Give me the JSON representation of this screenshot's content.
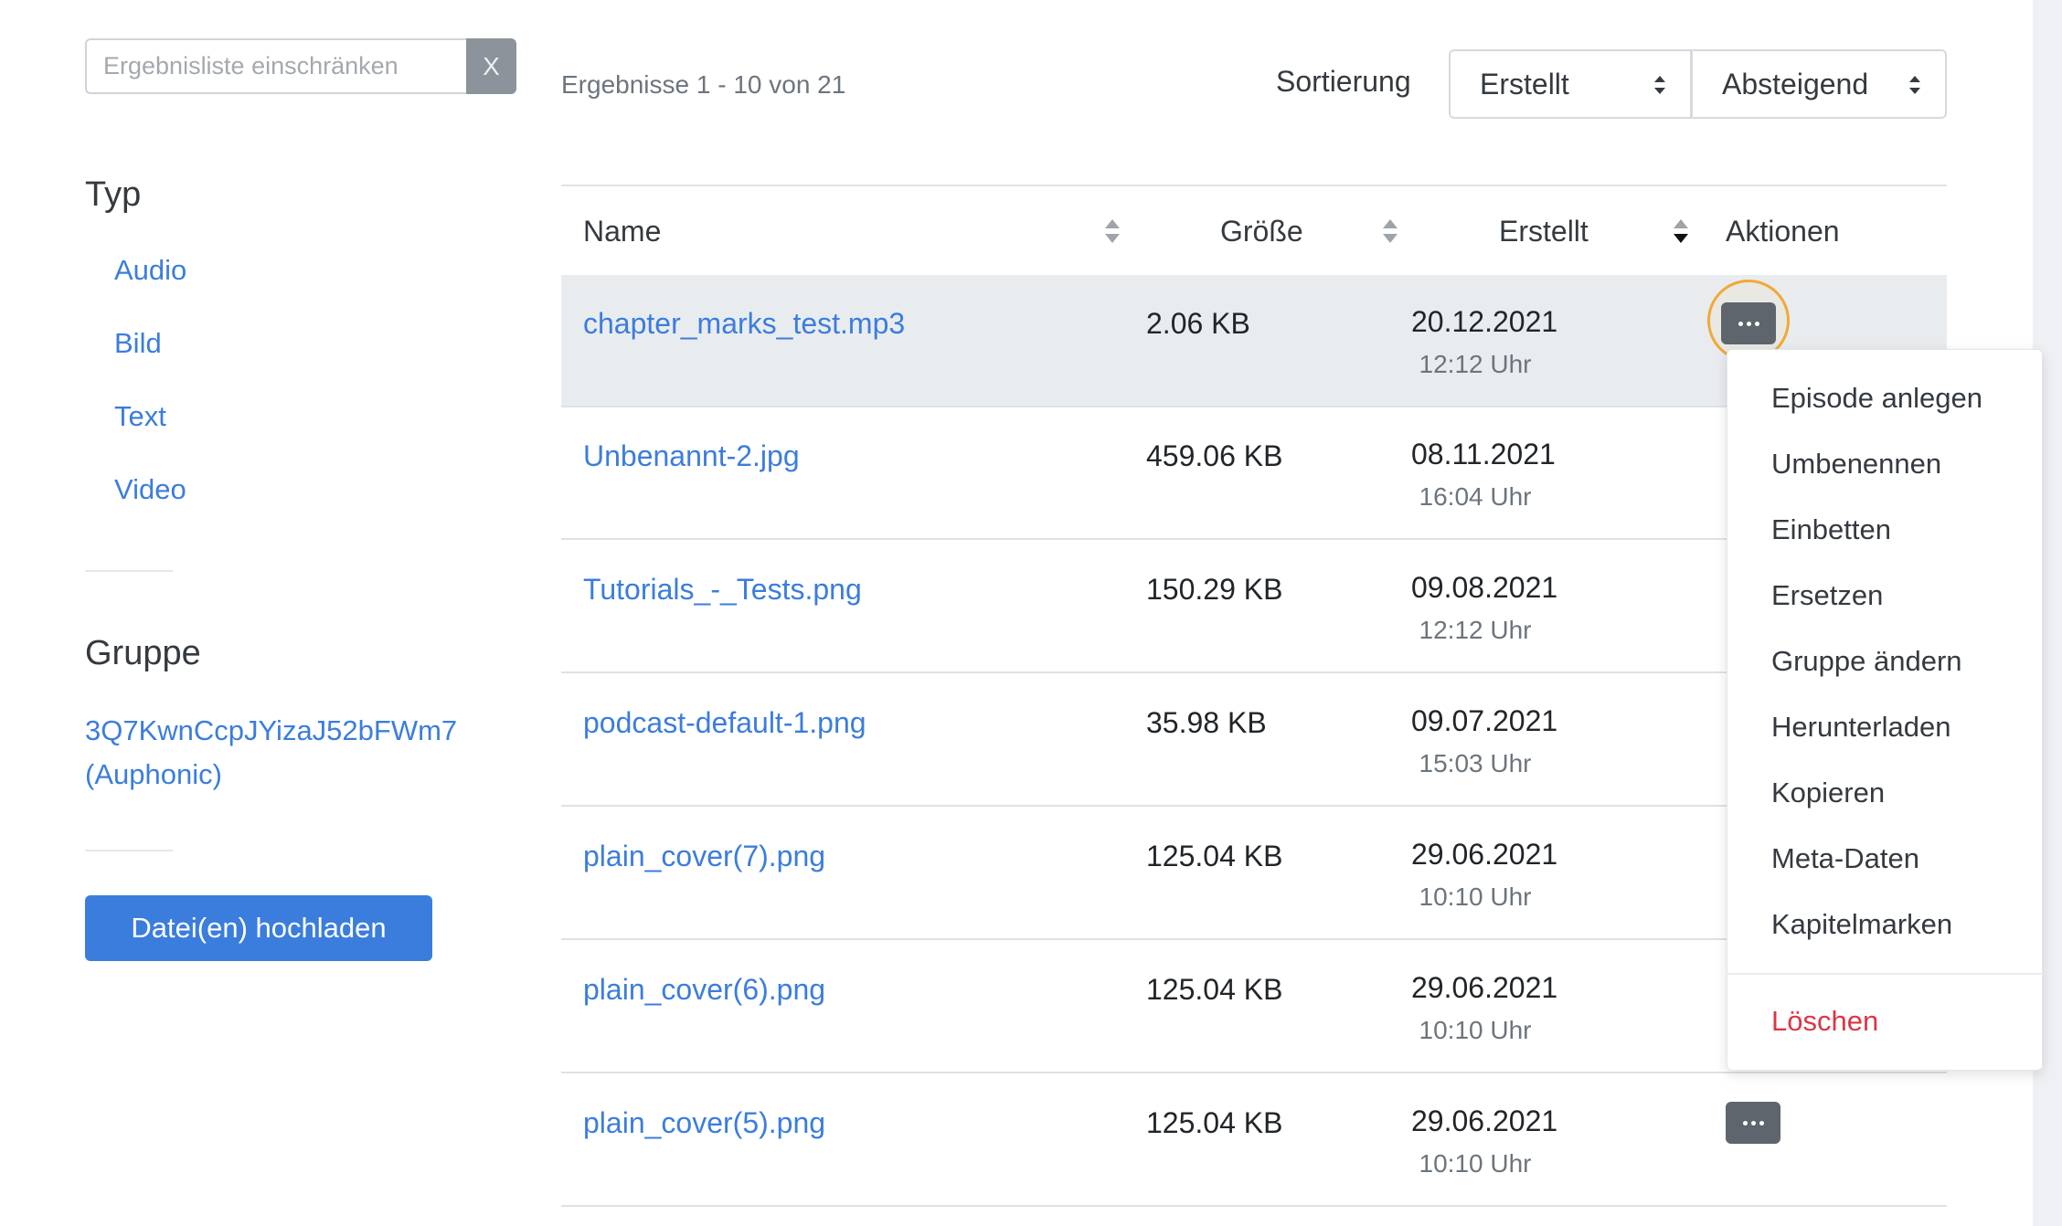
{
  "search": {
    "placeholder": "Ergebnisliste einschränken",
    "clear_label": "X"
  },
  "sidebar": {
    "type_heading": "Typ",
    "type_links": [
      "Audio",
      "Bild",
      "Text",
      "Video"
    ],
    "group_heading": "Gruppe",
    "group_link_line1": "3Q7KwnCcpJYizaJ52bFWm7",
    "group_link_line2": "(Auphonic)",
    "upload_label": "Datei(en) hochladen"
  },
  "toolbar": {
    "results_info": "Ergebnisse 1 - 10 von 21",
    "sort_label": "Sortierung",
    "sort_field": "Erstellt",
    "sort_order": "Absteigend"
  },
  "table": {
    "columns": {
      "name": "Name",
      "size": "Größe",
      "created": "Erstellt",
      "actions": "Aktionen"
    },
    "active_sort_column": "Erstellt",
    "rows": [
      {
        "name": "chapter_marks_test.mp3",
        "size": "2.06 KB",
        "date": "20.12.2021",
        "time": "12:12 Uhr"
      },
      {
        "name": "Unbenannt-2.jpg",
        "size": "459.06 KB",
        "date": "08.11.2021",
        "time": "16:04 Uhr"
      },
      {
        "name": "Tutorials_-_Tests.png",
        "size": "150.29 KB",
        "date": "09.08.2021",
        "time": "12:12 Uhr"
      },
      {
        "name": "podcast-default-1.png",
        "size": "35.98 KB",
        "date": "09.07.2021",
        "time": "15:03 Uhr"
      },
      {
        "name": "plain_cover(7).png",
        "size": "125.04 KB",
        "date": "29.06.2021",
        "time": "10:10 Uhr"
      },
      {
        "name": "plain_cover(6).png",
        "size": "125.04 KB",
        "date": "29.06.2021",
        "time": "10:10 Uhr"
      },
      {
        "name": "plain_cover(5).png",
        "size": "125.04 KB",
        "date": "29.06.2021",
        "time": "10:10 Uhr"
      }
    ]
  },
  "action_menu": {
    "items": [
      "Episode anlegen",
      "Umbenennen",
      "Einbetten",
      "Ersetzen",
      "Gruppe ändern",
      "Herunterladen",
      "Kopieren",
      "Meta-Daten",
      "Kapitelmarken"
    ],
    "delete_label": "Löschen"
  },
  "colors": {
    "link": "#3b7ddd",
    "primary_button": "#3b7ddd",
    "action_button": "#5f656c",
    "focus_ring": "#f0a938",
    "danger": "#dc3545",
    "active_row": "#e9ecef"
  },
  "icons": {
    "sort_both": "sort-both-icon",
    "sort_desc": "sort-desc-icon",
    "more_actions": "ellipsis-icon",
    "select_caret": "select-caret-icon"
  }
}
